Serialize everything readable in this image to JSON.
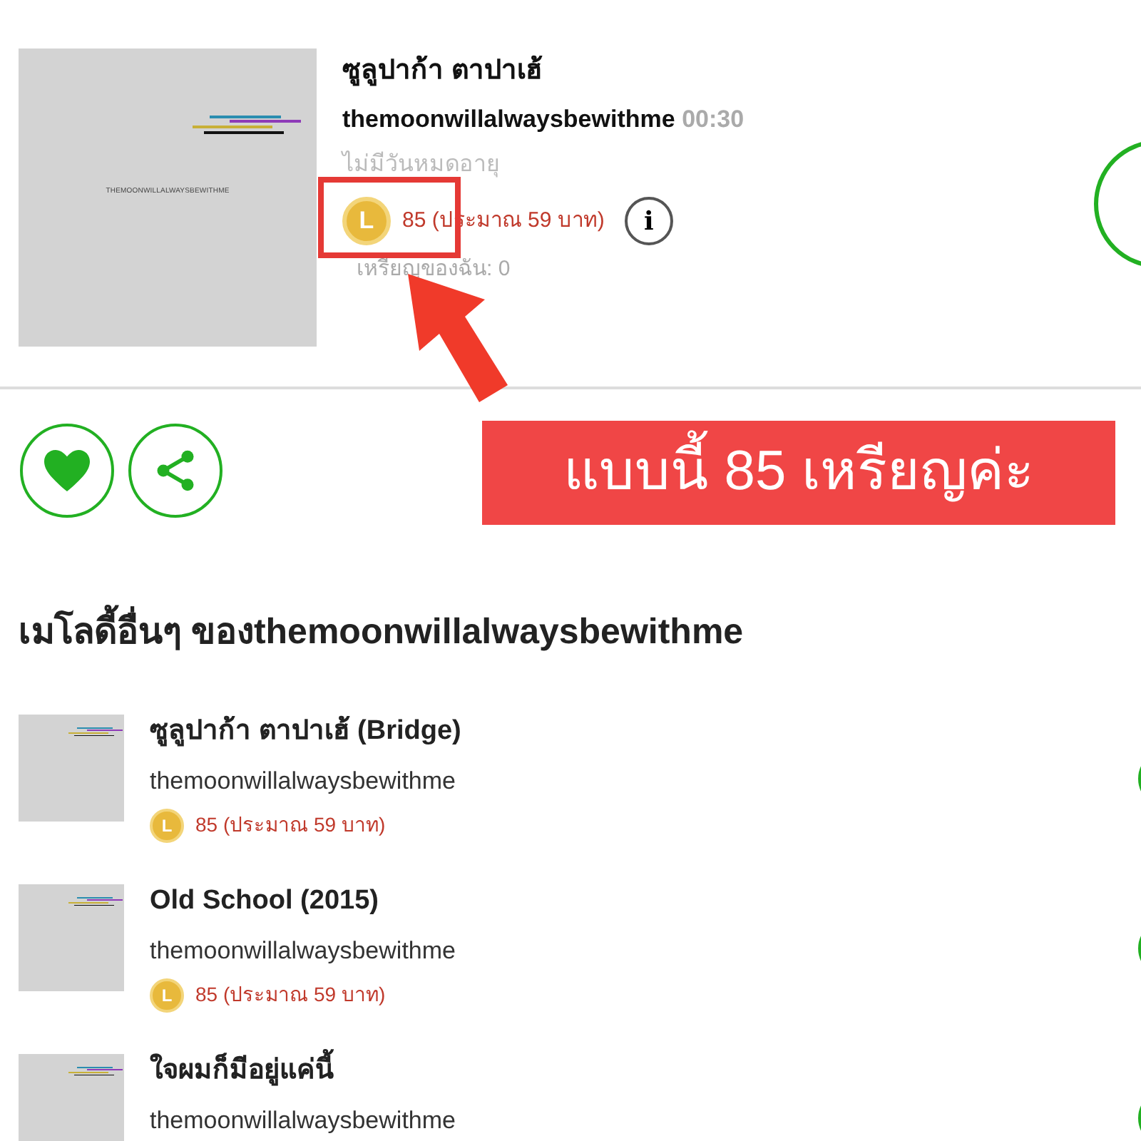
{
  "melody": {
    "cover_text": "THEMOONWILLALWAYSBEWITHME",
    "title": "ซูลูปาก้า ตาปาเฮ้",
    "artist": "themoonwillalwaysbewithme",
    "duration": "00:30",
    "expiry": "ไม่มีวันหมดอายุ",
    "coin_letter": "L",
    "price": "85 (ประมาณ 59 บาท)",
    "info_glyph": "i",
    "my_coins": "เหรียญของฉัน: 0"
  },
  "annotation": {
    "label": "แบบนี้ 85 เหรียญค่ะ"
  },
  "other_melodies": {
    "heading": "เมโลดี้อื่นๆ ของthemoonwillalwaysbewithme",
    "items": [
      {
        "title": "ซูลูปาก้า ตาปาเฮ้ (Bridge)",
        "artist": "themoonwillalwaysbewithme",
        "coin_letter": "L",
        "price": "85 (ประมาณ 59 บาท)"
      },
      {
        "title": "Old School (2015)",
        "artist": "themoonwillalwaysbewithme",
        "coin_letter": "L",
        "price": "85 (ประมาณ 59 บาท)"
      },
      {
        "title": "ใจผมก็มีอยู่แค่นี้",
        "artist": "themoonwillalwaysbewithme"
      }
    ]
  }
}
